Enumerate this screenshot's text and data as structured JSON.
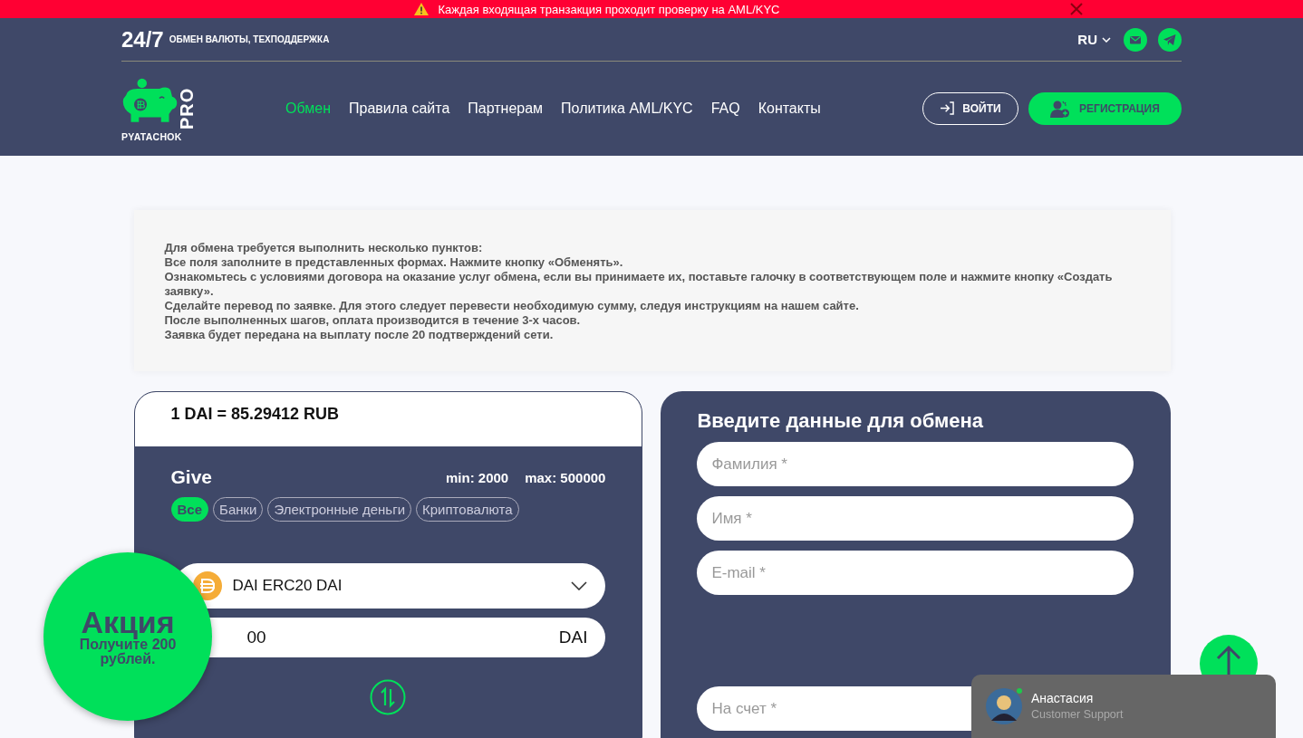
{
  "alert_bar": {
    "text": "Каждая входящая транзакция проходит проверку на AML/KYC"
  },
  "header": {
    "hours": "24/7",
    "tagline": "ОБМЕН ВАЛЮТЫ, ТЕХПОДДЕРЖКА",
    "language": "RU",
    "logo": {
      "name": "PYATACHOK",
      "suffix": "PRO"
    },
    "nav": [
      {
        "label": "Обмен",
        "selected": true
      },
      {
        "label": "Правила сайта",
        "selected": false
      },
      {
        "label": "Партнерам",
        "selected": false
      },
      {
        "label": "Политика AML/KYC",
        "selected": false
      },
      {
        "label": "FAQ",
        "selected": false
      },
      {
        "label": "Контакты",
        "selected": false
      }
    ],
    "login": "ВОЙТИ",
    "register": "РЕГИСТРАЦИЯ"
  },
  "instructions": [
    "Для обмена требуется выполнить несколько пунктов:",
    "Все поля заполните в представленных формах. Нажмите кнопку «Обменять».",
    "Ознакомьтесь с условиями договора на оказание услуг обмена, если вы принимаете их, поставьте галочку в соответствующем поле и нажмите кнопку «Создать заявку».",
    "Сделайте перевод по заявке.  Для этого следует перевести необходимую сумму, следуя инструкциям на нашем сайте.",
    "После выполненных шагов, оплата производится в течение 3-х часов.",
    "Заявка будет передана на выплату после 20 подтверждений сети."
  ],
  "exchange": {
    "rate": "1 DAI = 85.29412 RUB",
    "title": "Give",
    "min": "min: 2000",
    "max": "max: 500000",
    "filters": [
      {
        "label": "Все",
        "selected": true
      },
      {
        "label": "Банки",
        "selected": false
      },
      {
        "label": "Электронные деньги",
        "selected": false
      },
      {
        "label": "Криптовалюта",
        "selected": false
      }
    ],
    "currency": "DAI ERC20 DAI",
    "amount": "00",
    "unit": "DAI"
  },
  "form": {
    "title": "Введите данные для обмена",
    "fields": [
      {
        "placeholder": "Фамилия *"
      },
      {
        "placeholder": "Имя *"
      },
      {
        "placeholder": "E-mail *"
      },
      {
        "placeholder": "На счет *"
      }
    ]
  },
  "promo": {
    "title": "Акция",
    "text": "Получите 200 рублей."
  },
  "chat": {
    "name": "Анастасия",
    "role": "Customer Support",
    "online": true
  }
}
